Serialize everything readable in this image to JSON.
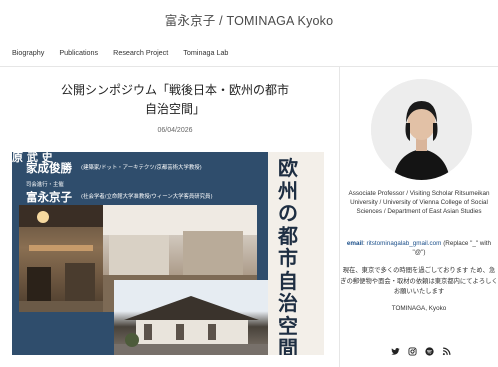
{
  "site": {
    "title": "富永京子 / TOMINAGA Kyoko"
  },
  "nav": {
    "items": [
      "Biography",
      "Publications",
      "Research Project",
      "Tominaga Lab"
    ]
  },
  "post": {
    "title_line1": "公開シンポジウム「戦後日本・欧州の都市",
    "title_line2": "自治空間」",
    "date": "06/04/2026"
  },
  "poster": {
    "top_cut": "原 武 史",
    "speaker1_name": "家成俊勝",
    "speaker1_role": "(建築家/ドット・アーキテクツ/京都芸術大学教授)",
    "moderator_label": "司会進行・主催",
    "speaker2_name": "富永京子",
    "speaker2_role": "(社会学者/立命館大学准教授/ウィーン大学客員研究員)",
    "vertical_text": "欧州の都市自治空間"
  },
  "sidebar": {
    "bio": "Associate Professor / Visiting Scholar Ritsumeikan University / University of Vienna College of Social Sciences / Department of East Asian Studies",
    "email_label": "email",
    "email": "ritstominagalab_gmail.com",
    "email_note": "(Replace \"_\" with \"@\")",
    "note": "現在、東京で多くの時間を過ごしております ため、急ぎの郵便物や面会・取材の依頼は東京都内にてよろしくお願いいたします",
    "signature": "TOMINAGA, Kyoko",
    "social_icons": [
      "twitter-icon",
      "instagram-icon",
      "spotify-icon",
      "rss-icon"
    ]
  }
}
